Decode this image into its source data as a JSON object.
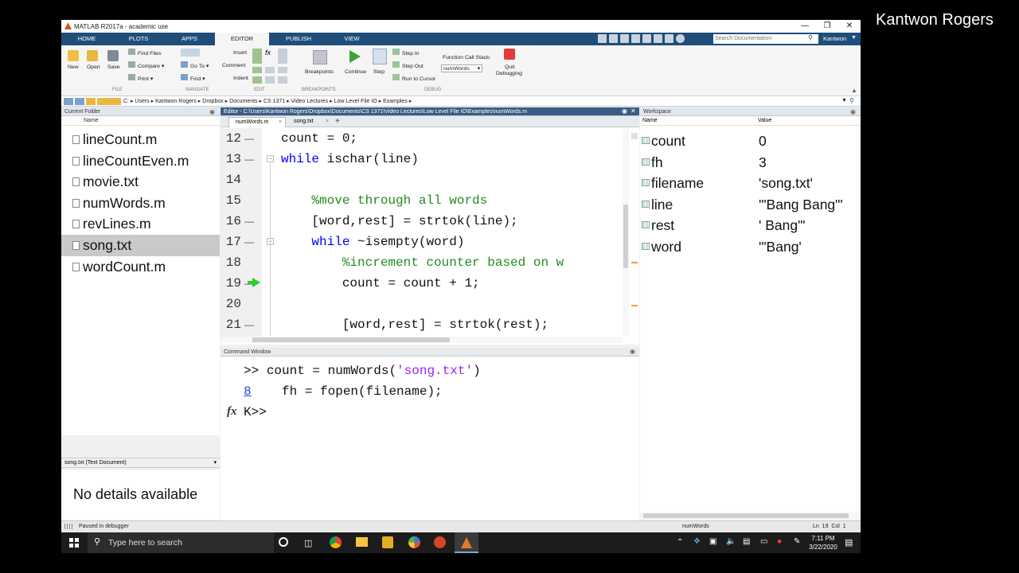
{
  "presenter": "Kantwon Rogers",
  "window": {
    "title": "MATLAB R2017a - academic use"
  },
  "tabs": [
    "HOME",
    "PLOTS",
    "APPS",
    "EDITOR",
    "PUBLISH",
    "VIEW"
  ],
  "search": {
    "placeholder": "Search Documentation"
  },
  "user": "Kantwon",
  "ribbon": {
    "file": {
      "new": "New",
      "open": "Open",
      "save": "Save",
      "find_files": "Find Files",
      "compare": "Compare",
      "print": "Print",
      "section": "FILE"
    },
    "navigate": {
      "go_to": "Go To",
      "find": "Find",
      "section": "NAVIGATE"
    },
    "edit": {
      "insert": "Insert",
      "comment": "Comment",
      "indent": "Indent",
      "section": "EDIT"
    },
    "breakpoints": {
      "label": "Breakpoints",
      "section": "BREAKPOINTS"
    },
    "debug": {
      "continue": "Continue",
      "step": "Step",
      "step_in": "Step In",
      "step_out": "Step Out",
      "run_to_cursor": "Run to Cursor",
      "call_stack_label": "Function Call Stack:",
      "call_stack_value": "numWords",
      "quit": "Quit",
      "quit2": "Debugging",
      "section": "DEBUG"
    }
  },
  "address": [
    "C:",
    "Users",
    "Kantwon Rogers",
    "Dropbox",
    "Documents",
    "CS 1371",
    "Video Lectures",
    "Low Level File IO",
    "Examples"
  ],
  "current_folder": {
    "title": "Current Folder",
    "col_name": "Name",
    "files": [
      "lineCount.m",
      "lineCountEven.m",
      "movie.txt",
      "numWords.m",
      "revLines.m",
      "song.txt",
      "wordCount.m"
    ],
    "details_title": "song.txt  (Text Document)",
    "details_text": "No details available"
  },
  "editor": {
    "title": "Editor - C:\\Users\\Kantwon Rogers\\Dropbox\\Documents\\CS 1371\\Video Lectures\\Low Level File IO\\Examples\\numWords.m",
    "tabs": [
      "numWords.m",
      "song.txt",
      "+"
    ],
    "lines": [
      {
        "n": "12",
        "dash": "—",
        "parts": [
          {
            "t": "count = 0;",
            "c": ""
          }
        ]
      },
      {
        "n": "13",
        "dash": "—",
        "parts": [
          {
            "t": "while",
            "c": "kw"
          },
          {
            "t": " ischar(line)",
            "c": ""
          }
        ]
      },
      {
        "n": "14",
        "dash": "",
        "parts": []
      },
      {
        "n": "15",
        "dash": "",
        "parts": [
          {
            "t": "    %move through all words",
            "c": "cm"
          }
        ]
      },
      {
        "n": "16",
        "dash": "—",
        "parts": [
          {
            "t": "    [word,rest] = strtok(line);",
            "c": ""
          }
        ]
      },
      {
        "n": "17",
        "dash": "—",
        "parts": [
          {
            "t": "    while",
            "c": "kw"
          },
          {
            "t": " ~isempty(word)",
            "c": ""
          }
        ]
      },
      {
        "n": "18",
        "dash": "",
        "parts": [
          {
            "t": "        %increment counter based on w",
            "c": "cm"
          }
        ]
      },
      {
        "n": "19",
        "dash": "—",
        "parts": [
          {
            "t": "        count = count + 1;",
            "c": ""
          }
        ]
      },
      {
        "n": "20",
        "dash": "",
        "parts": []
      },
      {
        "n": "21",
        "dash": "—",
        "parts": [
          {
            "t": "        [word,rest] = strtok(rest);",
            "c": ""
          }
        ]
      }
    ]
  },
  "command_window": {
    "title": "Command Window",
    "line1_prompt": ">> ",
    "line1_code": "count = numWords(",
    "line1_str": "'song.txt'",
    "line1_end": ")",
    "line2_num": "8",
    "line2_code": "    fh = fopen(filename);",
    "line3": "K>>",
    "fx": "fx"
  },
  "workspace": {
    "title": "Workspace",
    "col_name": "Name",
    "col_value": "Value",
    "vars": [
      {
        "name": "count",
        "value": "0"
      },
      {
        "name": "fh",
        "value": "3"
      },
      {
        "name": "filename",
        "value": "'song.txt'"
      },
      {
        "name": "line",
        "value": "'\"Bang Bang\"'"
      },
      {
        "name": "rest",
        "value": "' Bang\"'"
      },
      {
        "name": "word",
        "value": "'\"Bang'"
      }
    ]
  },
  "status": {
    "text": "Paused in debugger",
    "func": "numWords",
    "pos": "Ln  19  Col  1"
  },
  "taskbar": {
    "search": "Type here to search",
    "time": "7:11 PM",
    "date": "3/22/2020"
  }
}
